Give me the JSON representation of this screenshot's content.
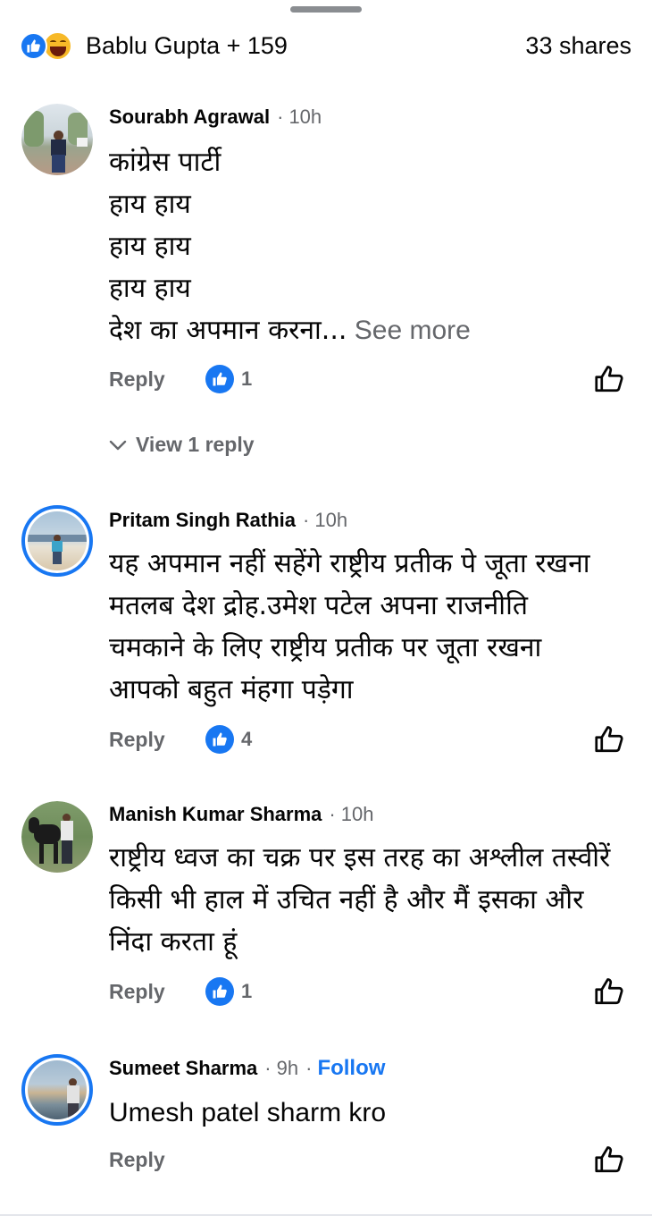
{
  "summary": {
    "reactors": "Bablu Gupta + 159",
    "shares": "33 shares",
    "reaction_icons": [
      "like-icon",
      "haha-icon"
    ]
  },
  "comments": [
    {
      "author": "Sourabh Agrawal",
      "time": "10h",
      "text": "कांग्रेस पार्टी\n हाय हाय\nहाय हाय\nहाय हाय\nदेश का अपमान करना...",
      "see_more": "See more",
      "reply_label": "Reply",
      "likes": "1",
      "view_replies": "View 1 reply"
    },
    {
      "author": "Pritam Singh Rathia",
      "time": "10h",
      "text": "यह अपमान नहीं सहेंगे राष्ट्रीय प्रतीक पे जूता रखना\nमतलब देश द्रोह.उमेश पटेल अपना राजनीति\nचमकाने के लिए राष्ट्रीय प्रतीक पर जूता रखना\nआपको बहुत मंहगा पड़ेगा",
      "reply_label": "Reply",
      "likes": "4"
    },
    {
      "author": "Manish Kumar Sharma",
      "time": "10h",
      "text": "राष्ट्रीय ध्वज का चक्र पर इस तरह का अश्लील तस्वीरें\nकिसी भी हाल में उचित नहीं है और मैं इसका और\nनिंदा करता हूं",
      "reply_label": "Reply",
      "likes": "1"
    },
    {
      "author": "Sumeet Sharma",
      "time": "9h",
      "follow_label": "Follow",
      "text": "Umesh patel sharm kro",
      "reply_label": "Reply"
    }
  ],
  "colors": {
    "accent": "#1877f2",
    "secondary_text": "#65676b",
    "primary_text": "#050505"
  }
}
